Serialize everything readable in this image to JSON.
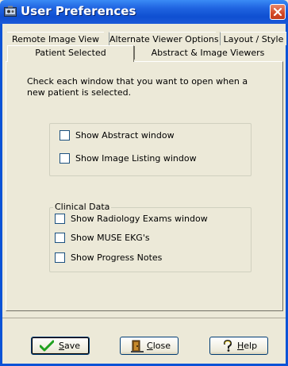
{
  "window": {
    "title": "User Preferences"
  },
  "tabs": {
    "row1": [
      {
        "label": "Remote Image View"
      },
      {
        "label": "Alternate Viewer Options"
      },
      {
        "label": "Layout / Style"
      }
    ],
    "row2": [
      {
        "label": "Patient Selected",
        "selected": true
      },
      {
        "label": "Abstract & Image Viewers",
        "selected": false
      }
    ]
  },
  "panel": {
    "instructions": "Check each window that you want to open when a new patient is selected.",
    "windows_group": {
      "items": [
        {
          "label": "Show Abstract window",
          "checked": false
        },
        {
          "label": "Show Image Listing window",
          "checked": false
        }
      ]
    },
    "clinical_group": {
      "title": "Clinical Data",
      "items": [
        {
          "label": "Show Radiology Exams window",
          "checked": false
        },
        {
          "label": "Show MUSE EKG's",
          "checked": false
        },
        {
          "label": "Show Progress Notes",
          "checked": false
        }
      ]
    }
  },
  "buttons": {
    "save": {
      "prefix": "",
      "mnemonic": "S",
      "rest": "ave",
      "icon": "checkmark-icon"
    },
    "close": {
      "prefix": "",
      "mnemonic": "C",
      "rest": "lose",
      "icon": "door-exit-icon"
    },
    "help": {
      "prefix": "",
      "mnemonic": "H",
      "rest": "elp",
      "icon": "question-icon"
    }
  },
  "colors": {
    "titlebar": "#0f4fd1",
    "face": "#ece9d8",
    "checkbox_border": "#1c5180",
    "checkmark": "#21a121"
  }
}
